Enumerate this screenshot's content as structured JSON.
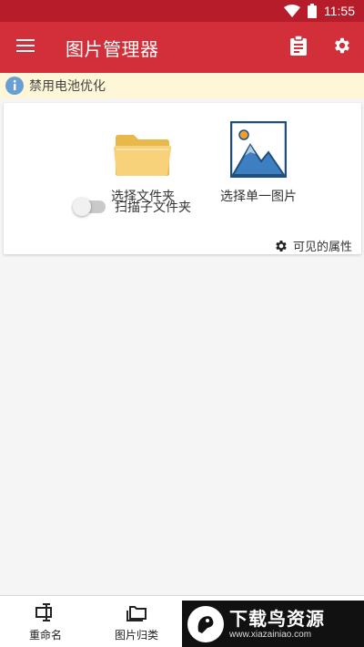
{
  "status_bar": {
    "time": "11:55",
    "wifi_icon": "wifi-icon",
    "battery_icon": "battery-icon"
  },
  "app_bar": {
    "title": "图片管理器",
    "menu_icon": "hamburger-menu-icon",
    "clipboard_icon": "clipboard-icon",
    "settings_icon": "gear-icon",
    "color": "#d32f3a",
    "status_color": "#b71c2b"
  },
  "notice": {
    "text": "禁用电池优化",
    "icon": "info-icon",
    "background": "#fdf6d7"
  },
  "card": {
    "select_folder_label": "选择文件夹",
    "select_image_label": "选择单一图片",
    "scan_subfolders_label": "扫描子文件夹",
    "scan_subfolders_on": false,
    "visible_properties_label": "可见的属性"
  },
  "bottom_nav": {
    "rename_label": "重命名",
    "categorize_label": "图片归类"
  },
  "watermark": {
    "name": "下载鸟资源",
    "url": "www.xiazainiao.com"
  }
}
